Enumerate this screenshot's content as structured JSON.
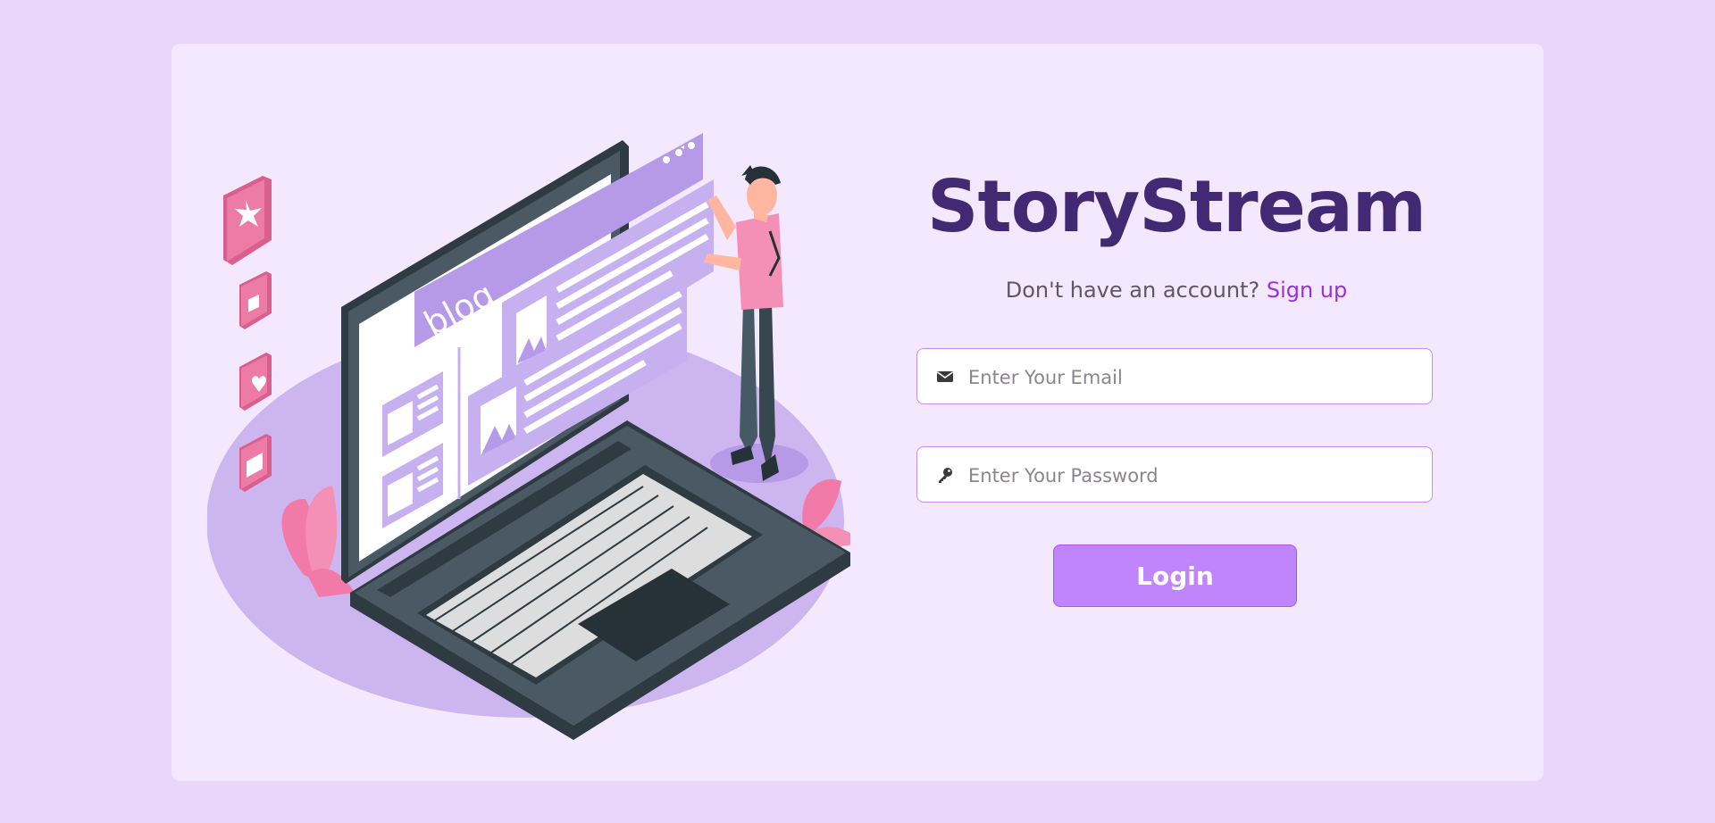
{
  "brand": {
    "title": "StoryStream"
  },
  "signup": {
    "prompt": "Don't have an account?",
    "link_label": "Sign up"
  },
  "email": {
    "placeholder": "Enter Your Email",
    "value": "",
    "icon": "envelope-icon"
  },
  "password": {
    "placeholder": "Enter Your Password",
    "value": "",
    "icon": "key-icon"
  },
  "login": {
    "label": "Login"
  },
  "illustration": {
    "screen_label": "blog"
  },
  "colors": {
    "page_bg": "#ead6fb",
    "card_bg": "#f3e8fe",
    "brand": "#432874",
    "link": "#9a2fe0",
    "button": "#c084fc",
    "field_border": "#c68ef2"
  }
}
